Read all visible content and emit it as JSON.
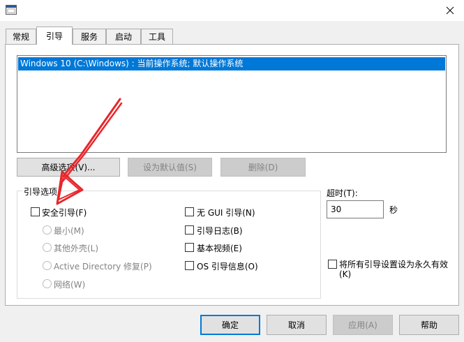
{
  "tabs": [
    {
      "label": "常规"
    },
    {
      "label": "引导"
    },
    {
      "label": "服务"
    },
    {
      "label": "启动"
    },
    {
      "label": "工具"
    }
  ],
  "os_list": {
    "items": [
      "Windows 10 (C:\\Windows) : 当前操作系统; 默认操作系统"
    ]
  },
  "boot_buttons": {
    "advanced": "高级选项(V)...",
    "set_default": "设为默认值(S)",
    "delete": "删除(D)"
  },
  "boot_options": {
    "group_label": "引导选项",
    "safe_boot": "安全引导(F)",
    "minimal": "最小(M)",
    "alternate_shell": "其他外壳(L)",
    "active_directory": "Active Directory 修复(P)",
    "network": "网络(W)",
    "no_gui": "无 GUI 引导(N)",
    "boot_log": "引导日志(B)",
    "base_video": "基本视频(E)",
    "os_boot_info": "OS 引导信息(O)"
  },
  "timeout": {
    "label": "超时(T):",
    "value": "30",
    "unit": "秒"
  },
  "permanent": {
    "line1": "将所有引导设置设为永久有效",
    "line2": "(K)"
  },
  "footer": {
    "ok": "确定",
    "cancel": "取消",
    "apply": "应用(A)",
    "help": "帮助"
  },
  "colors": {
    "selection": "#0078d7",
    "annotation_arrow": "#e8262b"
  },
  "icons": {
    "app": "window-app-icon",
    "close": "close-icon"
  }
}
